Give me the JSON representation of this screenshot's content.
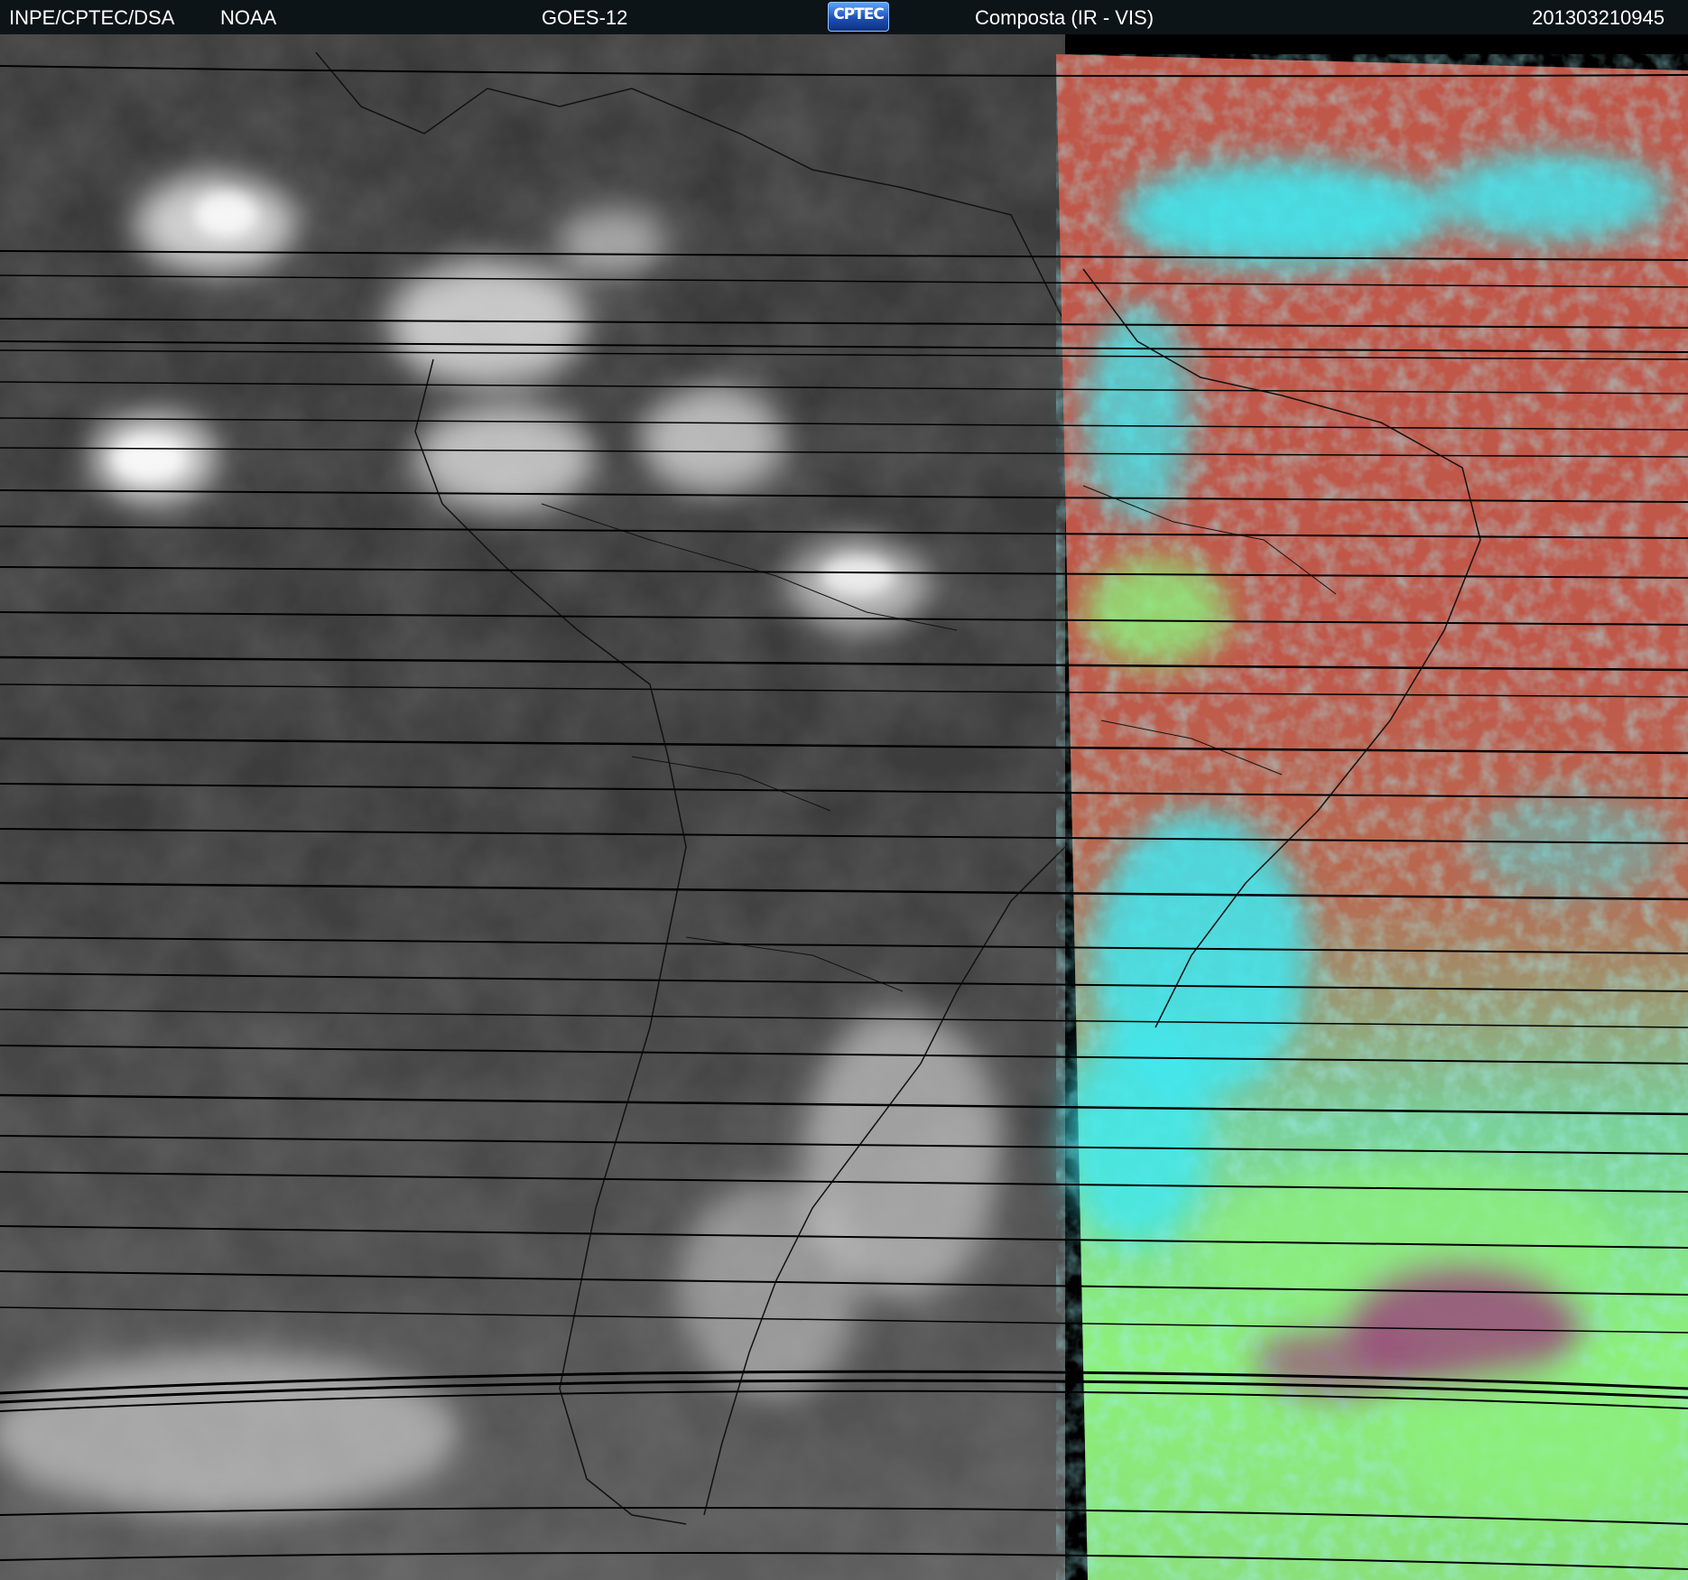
{
  "header": {
    "organization": "INPE/CPTEC/DSA",
    "agency": "NOAA",
    "satellite": "GOES-12",
    "logo_text": "CPTEC",
    "product": "Composta (IR - VIS)",
    "timestamp": "201303210945"
  },
  "colors": {
    "header_bg": "#0d1418",
    "ir_panel_gray": "#3c3c3c",
    "cloud_white": "#f0f0f0",
    "vis_red": "#c0584a",
    "vis_cyan": "#3ee8f0",
    "vis_green": "#8cf07a",
    "vis_magenta": "#9a4a7a",
    "scan_line": "#000000"
  },
  "icons": {
    "logo": "cptec-logo"
  }
}
